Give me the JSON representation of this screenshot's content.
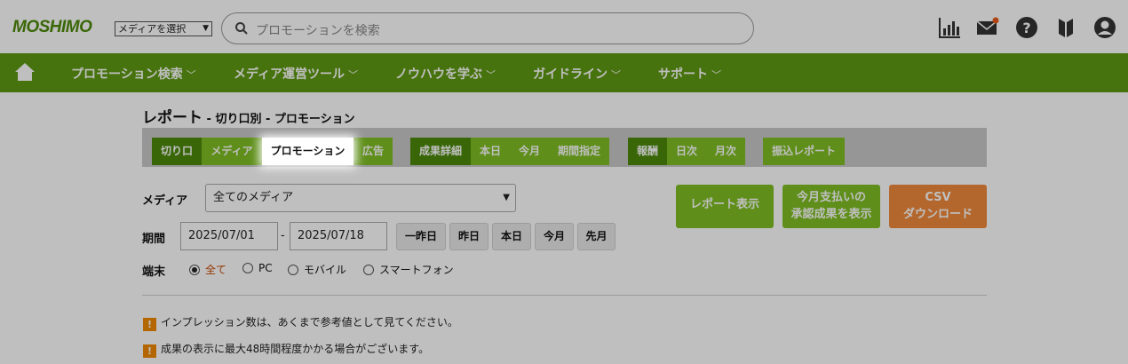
{
  "header": {
    "logo": "MOSHIMO",
    "media_select": "メディアを選択",
    "search_placeholder": "プロモーションを検索"
  },
  "nav": {
    "items": [
      {
        "label": "プロモーション検索"
      },
      {
        "label": "メディア運営ツール"
      },
      {
        "label": "ノウハウを学ぶ"
      },
      {
        "label": "ガイドライン"
      },
      {
        "label": "サポート"
      }
    ]
  },
  "page": {
    "title": "レポート",
    "subtitle": " - 切り口別 - プロモーション"
  },
  "tabs": {
    "group1": [
      "切り口",
      "メディア",
      "プロモーション",
      "広告"
    ],
    "group2": [
      "成果詳細",
      "本日",
      "今月",
      "期間指定"
    ],
    "group3": [
      "報酬",
      "日次",
      "月次"
    ],
    "group4": [
      "振込レポート"
    ]
  },
  "form": {
    "media_label": "メディア",
    "media_value": "全てのメディア",
    "period_label": "期間",
    "date_from": "2025/07/01",
    "date_sep": "-",
    "date_to": "2025/07/18",
    "quick": [
      "一昨日",
      "昨日",
      "本日",
      "今月",
      "先月"
    ],
    "device_label": "端末",
    "devices": [
      "全て",
      "PC",
      "モバイル",
      "スマートフォン"
    ]
  },
  "actions": {
    "report": "レポート表示",
    "approve_line1": "今月支払いの",
    "approve_line2": "承認成果を表示",
    "csv_line1": "CSV",
    "csv_line2": "ダウンロード"
  },
  "notes": [
    "インプレッション数は、あくまで参考値として見てください。",
    "成果の表示に最大48時間程度かかる場合がございます。"
  ],
  "colors": {
    "nav_green": "#5e9a12",
    "tab_dark": "#4c8a0b",
    "tab_light": "#7fbf23",
    "csv_orange": "#f08a3c",
    "warn": "#f08a00"
  }
}
